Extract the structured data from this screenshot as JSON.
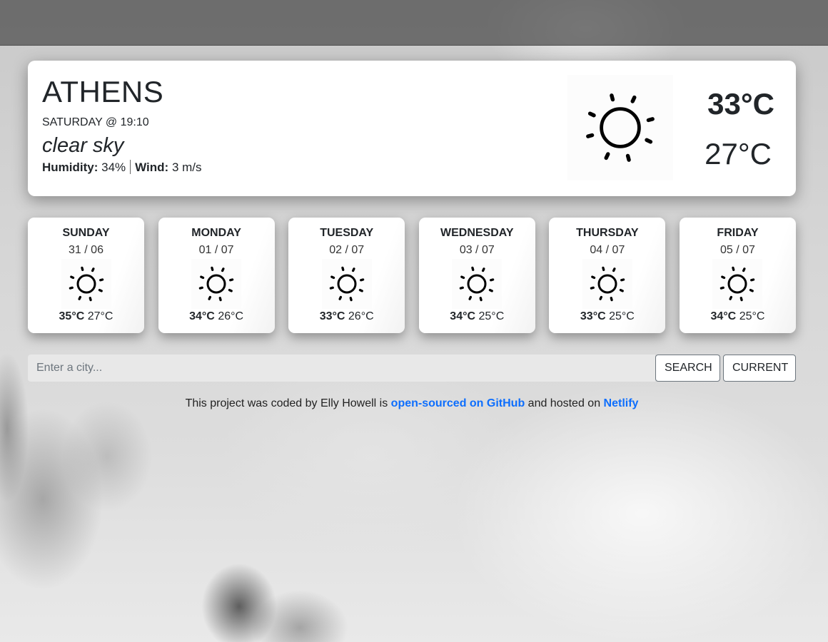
{
  "current": {
    "city": "ATHENS",
    "datetime": "SATURDAY @ 19:10",
    "description": "clear sky",
    "humidity_label": "Humidity:",
    "humidity_value": "34%",
    "wind_label": "Wind:",
    "wind_value": "3 m/s",
    "icon": "clear-sky-sun-icon",
    "temp_high": "33°C",
    "temp_low": "27°C"
  },
  "forecast": [
    {
      "day": "SUNDAY",
      "date": "31 / 06",
      "icon": "sun-icon",
      "high": "35°C",
      "low": "27°C"
    },
    {
      "day": "MONDAY",
      "date": "01 / 07",
      "icon": "sun-icon",
      "high": "34°C",
      "low": "26°C"
    },
    {
      "day": "TUESDAY",
      "date": "02 / 07",
      "icon": "sun-icon",
      "high": "33°C",
      "low": "26°C"
    },
    {
      "day": "WEDNESDAY",
      "date": "03 / 07",
      "icon": "sun-icon",
      "high": "34°C",
      "low": "25°C"
    },
    {
      "day": "THURSDAY",
      "date": "04 / 07",
      "icon": "sun-icon",
      "high": "33°C",
      "low": "25°C"
    },
    {
      "day": "FRIDAY",
      "date": "05 / 07",
      "icon": "sun-icon",
      "high": "34°C",
      "low": "25°C"
    }
  ],
  "search": {
    "placeholder": "Enter a city...",
    "value": "",
    "search_label": "SEARCH",
    "current_label": "CURRENT"
  },
  "footer": {
    "text_before": "This project was coded by Elly Howell is ",
    "github_link": "open-sourced on GitHub",
    "text_middle": " and hosted on ",
    "netlify_link": "Netlify"
  },
  "colors": {
    "link": "#0d6efd",
    "text": "#212529"
  }
}
